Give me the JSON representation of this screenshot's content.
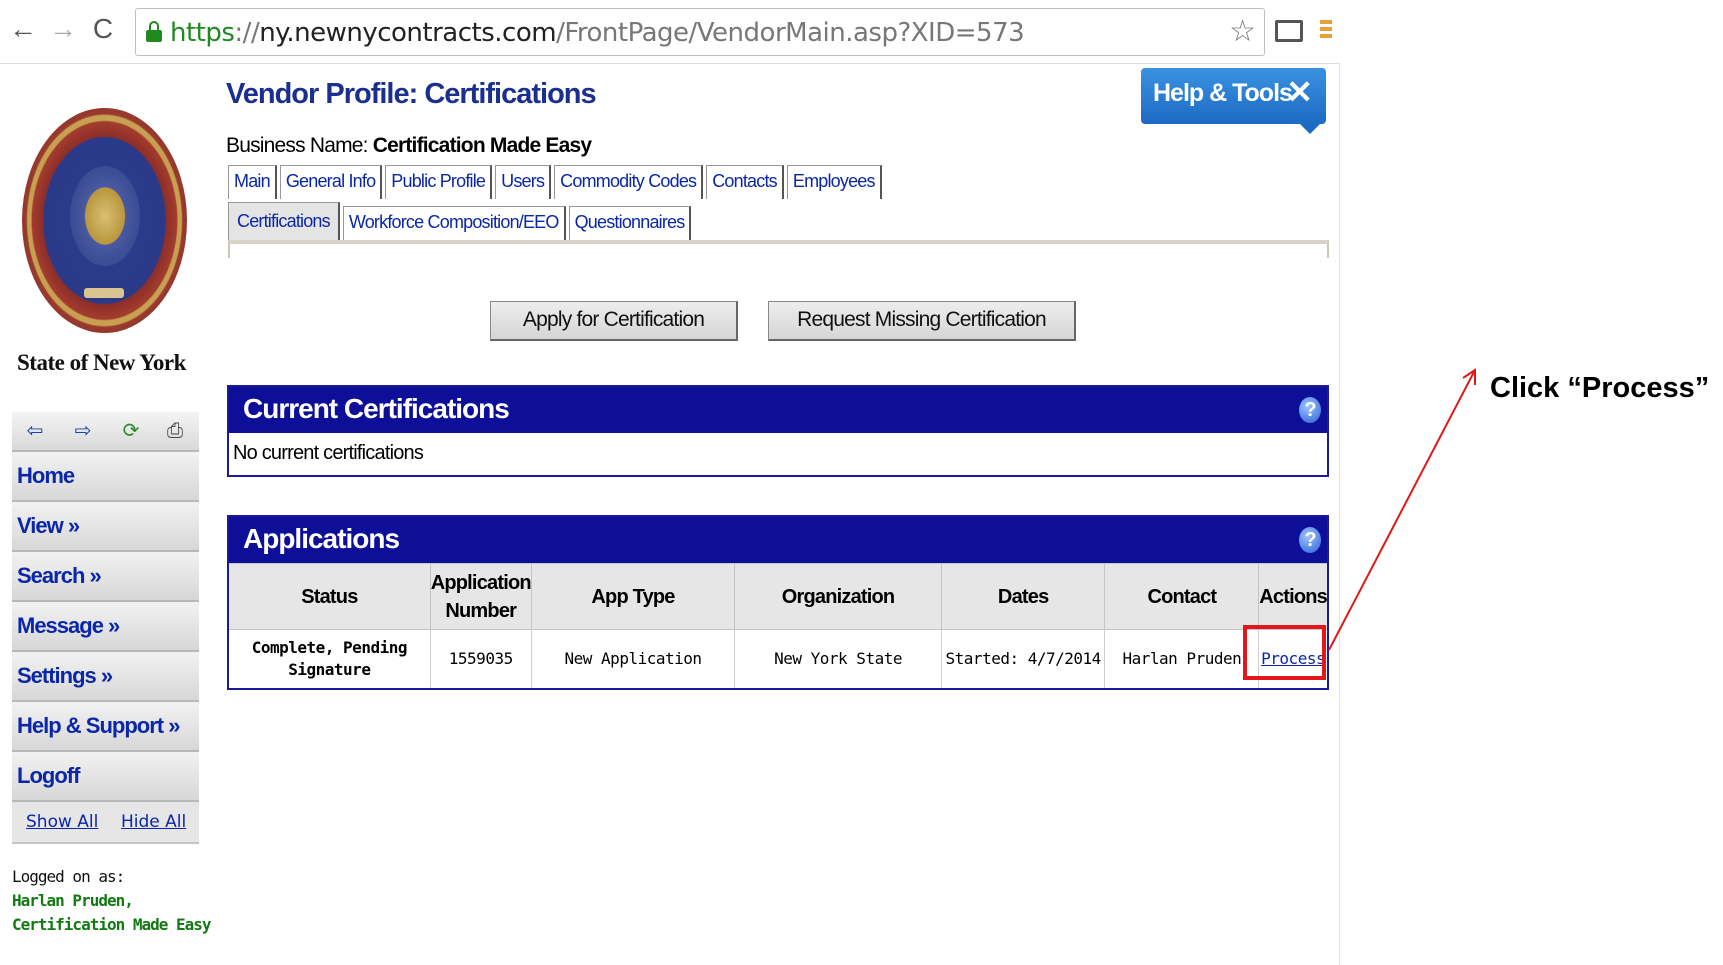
{
  "browser": {
    "url_scheme": "https",
    "url_sep": "://",
    "url_host": "ny.newnycontracts.com",
    "url_path": "/FrontPage/VendorMain.asp?XID=573"
  },
  "left": {
    "state_label": "State of New York",
    "nav": [
      "Home",
      "View »",
      "Search »",
      "Message »",
      "Settings »",
      "Help & Support »",
      "Logoff"
    ],
    "show_all": "Show All",
    "hide_all": "Hide All",
    "logged_label": "Logged on as:",
    "logged_user": "Harlan Pruden,",
    "logged_org": "Certification Made Easy"
  },
  "header": {
    "title": "Vendor Profile: Certifications",
    "help_tools": "Help & Tools",
    "business_label": "Business Name: ",
    "business_name": "Certification Made Easy"
  },
  "tabs_row1": [
    "Main",
    "General Info",
    "Public Profile",
    "Users",
    "Commodity Codes",
    "Contacts",
    "Employees"
  ],
  "tabs_row2": [
    "Certifications",
    "Workforce Composition/EEO",
    "Questionnaires"
  ],
  "buttons": {
    "apply": "Apply for Certification",
    "request": "Request Missing Certification"
  },
  "current": {
    "title": "Current Certifications",
    "empty": "No current certifications"
  },
  "applications": {
    "title": "Applications",
    "columns": [
      "Status",
      "Application Number",
      "App Type",
      "Organization",
      "Dates",
      "Contact",
      "Actions"
    ],
    "row": {
      "status": "Complete, Pending Signature",
      "number": "1559035",
      "type": "New Application",
      "org": "New York State",
      "dates": "Started: 4/7/2014",
      "contact": "Harlan Pruden",
      "action": "Process"
    }
  },
  "annotation": {
    "text": "Click “Process”",
    "color": "#e21818"
  },
  "colors": {
    "panel_header": "#0e0f98",
    "link": "#0a27a8",
    "title": "#1a2f8f"
  }
}
